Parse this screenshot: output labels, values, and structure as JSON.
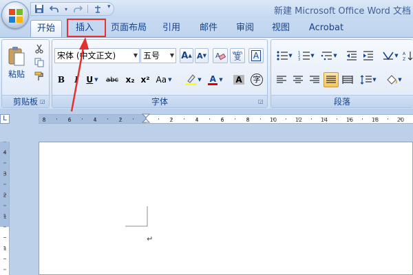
{
  "window": {
    "title": "新建 Microsoft Office Word 文档"
  },
  "quick_access": {
    "more_glyph": "▾"
  },
  "tabs": [
    {
      "label": "开始",
      "active": true
    },
    {
      "label": "插入",
      "active": false,
      "highlighted": true
    },
    {
      "label": "页面布局",
      "active": false
    },
    {
      "label": "引用",
      "active": false
    },
    {
      "label": "邮件",
      "active": false
    },
    {
      "label": "审阅",
      "active": false
    },
    {
      "label": "视图",
      "active": false
    },
    {
      "label": "Acrobat",
      "active": false
    }
  ],
  "clipboard": {
    "group_label": "剪贴板",
    "paste_label": "粘贴"
  },
  "font": {
    "group_label": "字体",
    "font_name": "宋体 (中文正文)",
    "font_size": "五号",
    "bold": "B",
    "italic": "I",
    "underline": "U",
    "strike": "abc",
    "sub": "x₂",
    "sup": "x²",
    "case": "Aa",
    "grow": "A",
    "shrink": "A",
    "phonetic": "wén",
    "phonetic_char": "变",
    "border_char": "A",
    "shade_char": "A",
    "enclose_char": "字",
    "font_color_char": "A"
  },
  "paragraph": {
    "group_label": "段落"
  },
  "ruler": {
    "corner_glyph": "L",
    "h_labels": [
      "8",
      "6",
      "4",
      "2",
      "2",
      "4",
      "6",
      "8",
      "10",
      "12",
      "14",
      "16",
      "18",
      "20"
    ],
    "v_labels": [
      "4",
      "3",
      "2",
      "1",
      "1"
    ]
  },
  "document": {
    "paragraph_mark": "↵"
  },
  "colors": {
    "highlight_yellow": "#ffff00",
    "font_red": "#e00000",
    "annotation_red": "#e53030"
  }
}
